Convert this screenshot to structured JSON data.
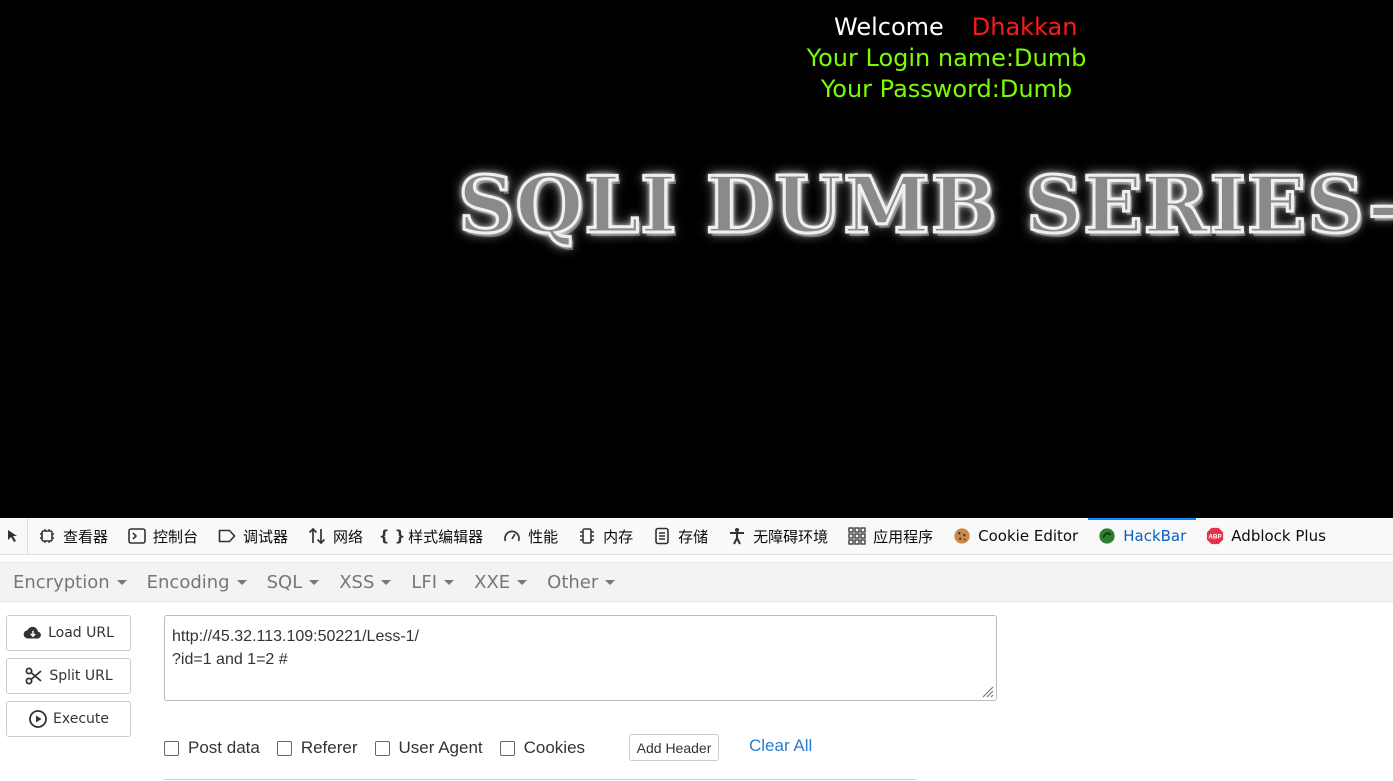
{
  "webpage": {
    "welcome_label": "Welcome",
    "welcome_name": "Dhakkan",
    "login_line": "Your Login name:Dumb",
    "password_line": "Your Password:Dumb",
    "banner": "SQLI DUMB SERIES-"
  },
  "devtools": {
    "tabs": [
      {
        "label": "查看器",
        "icon": "inspector-icon"
      },
      {
        "label": "控制台",
        "icon": "console-icon"
      },
      {
        "label": "调试器",
        "icon": "debugger-icon"
      },
      {
        "label": "网络",
        "icon": "network-icon"
      },
      {
        "label": "样式编辑器",
        "icon": "style-editor-icon"
      },
      {
        "label": "性能",
        "icon": "performance-icon"
      },
      {
        "label": "内存",
        "icon": "memory-icon"
      },
      {
        "label": "存储",
        "icon": "storage-icon"
      },
      {
        "label": "无障碍环境",
        "icon": "accessibility-icon"
      },
      {
        "label": "应用程序",
        "icon": "application-icon"
      },
      {
        "label": "Cookie Editor",
        "icon": "cookie-icon"
      },
      {
        "label": "HackBar",
        "icon": "hackbar-icon"
      },
      {
        "label": "Adblock Plus",
        "icon": "abp-icon"
      }
    ],
    "active_tab": "HackBar"
  },
  "hackbar": {
    "menus": [
      "Encryption",
      "Encoding",
      "SQL",
      "XSS",
      "LFI",
      "XXE",
      "Other"
    ],
    "load_url": "Load URL",
    "split_url": "Split URL",
    "execute": "Execute",
    "url_line1": "http://45.32.113.109:50221/Less-1/",
    "url_line2": "?id=1 and 1=2 #",
    "options": [
      "Post data",
      "Referer",
      "User Agent",
      "Cookies"
    ],
    "add_header": "Add Header",
    "clear_all": "Clear All"
  },
  "colors": {
    "welcome_name": "#ff1a1a",
    "green_text": "#7cfc00",
    "active_tab": "#0a60c2",
    "clear_all": "#2a7bd0"
  }
}
